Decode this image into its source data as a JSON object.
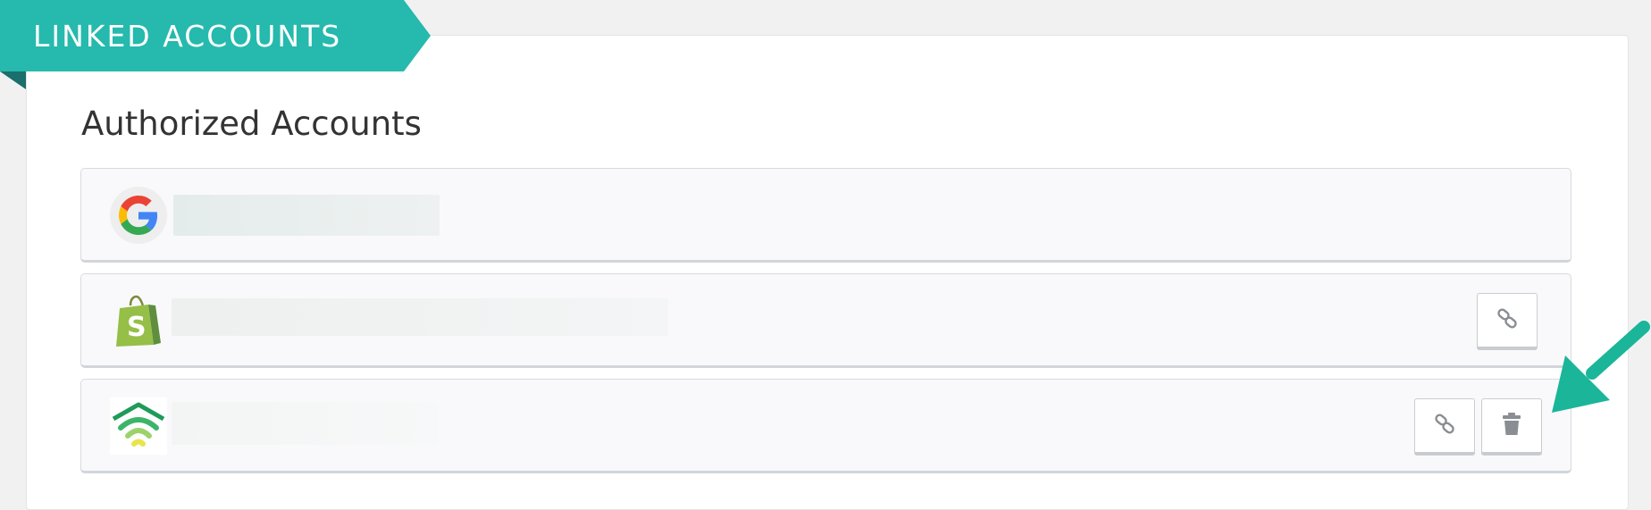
{
  "header": {
    "ribbon_label": "LINKED ACCOUNTS"
  },
  "section": {
    "title": "Authorized Accounts"
  },
  "accounts": [
    {
      "provider": "google",
      "icon": "google-logo-icon",
      "actions": []
    },
    {
      "provider": "shopify",
      "icon": "shopify-logo-icon",
      "actions": [
        "link-icon"
      ]
    },
    {
      "provider": "wifi-service",
      "icon": "wifi-logo-icon",
      "actions": [
        "link-icon",
        "trash-icon"
      ]
    }
  ],
  "colors": {
    "ribbon": "#26b9ad",
    "ribbon_fold": "#1b6f6c",
    "arrow": "#1bb59a",
    "icon_gray": "#8a8d91"
  }
}
